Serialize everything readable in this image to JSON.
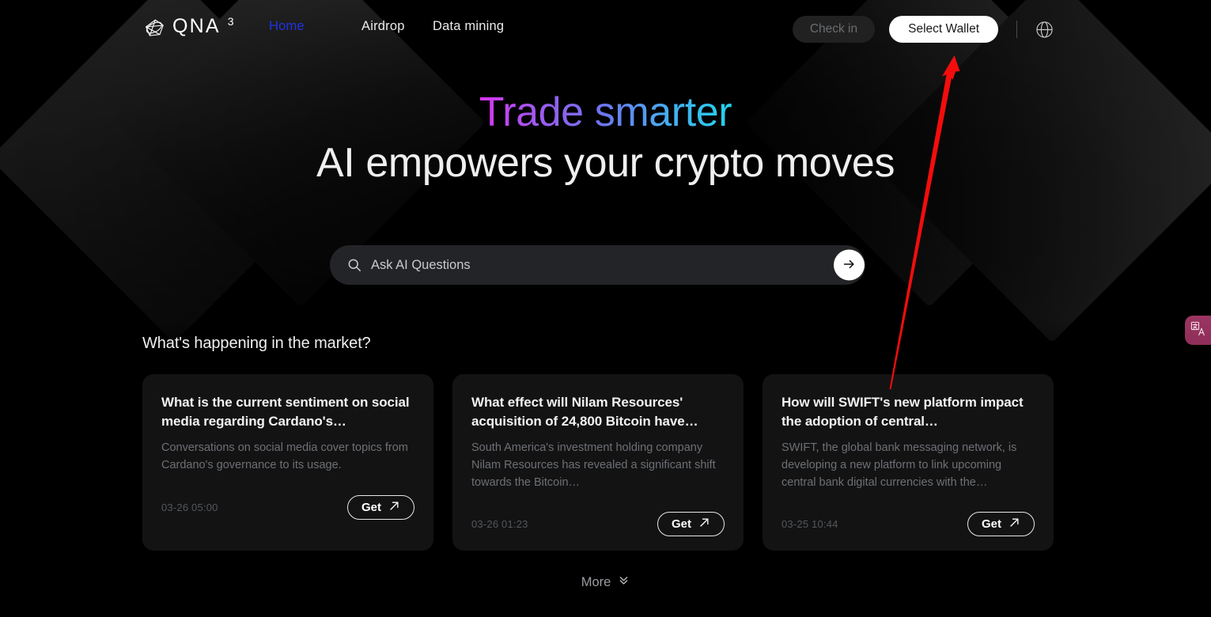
{
  "brand": {
    "logo_icon": "gem-diamond-icon",
    "name": "QNA",
    "superscript": "3"
  },
  "nav": {
    "items": [
      {
        "label": "Home",
        "active": true
      },
      {
        "label": "Airdrop",
        "active": false
      },
      {
        "label": "Data mining",
        "active": false
      }
    ]
  },
  "header_actions": {
    "check_in_label": "Check in",
    "select_wallet_label": "Select Wallet",
    "language_icon": "globe-icon"
  },
  "hero": {
    "line1": "Trade smarter",
    "line2": "AI empowers your crypto moves",
    "gradient_from": "#d836f0",
    "gradient_mid": "#6f74ef",
    "gradient_to": "#22d3ee"
  },
  "search": {
    "placeholder": "Ask AI Questions",
    "value": "",
    "icon": "search-icon",
    "submit_icon": "arrow-right-icon"
  },
  "market": {
    "heading": "What's happening in the market?",
    "cards": [
      {
        "title": "What is the current sentiment on social media regarding Cardano's…",
        "desc": "Conversations on social media cover topics from Cardano's governance to its usage.",
        "time": "03-26 05:00",
        "action_label": "Get"
      },
      {
        "title": "What effect will Nilam Resources' acquisition of 24,800 Bitcoin have…",
        "desc": "South America's investment holding company Nilam Resources has revealed a significant shift towards the Bitcoin…",
        "time": "03-26 01:23",
        "action_label": "Get"
      },
      {
        "title": "How will SWIFT's new platform impact the adoption of central…",
        "desc": "SWIFT, the global bank messaging network, is developing a new platform to link upcoming central bank digital currencies with the…",
        "time": "03-25 10:44",
        "action_label": "Get"
      }
    ],
    "more_label": "More",
    "more_icon": "chevron-double-down-icon"
  },
  "translate_widget": {
    "icon": "translate-icon",
    "color": "#9c3461"
  },
  "annotation": {
    "type": "arrow",
    "color": "#f40d0d",
    "points_to": "select-wallet-button"
  },
  "colors": {
    "background": "#000000",
    "card_bg": "#131314",
    "accent_blue": "#1f33e2",
    "search_bg": "#232427"
  }
}
